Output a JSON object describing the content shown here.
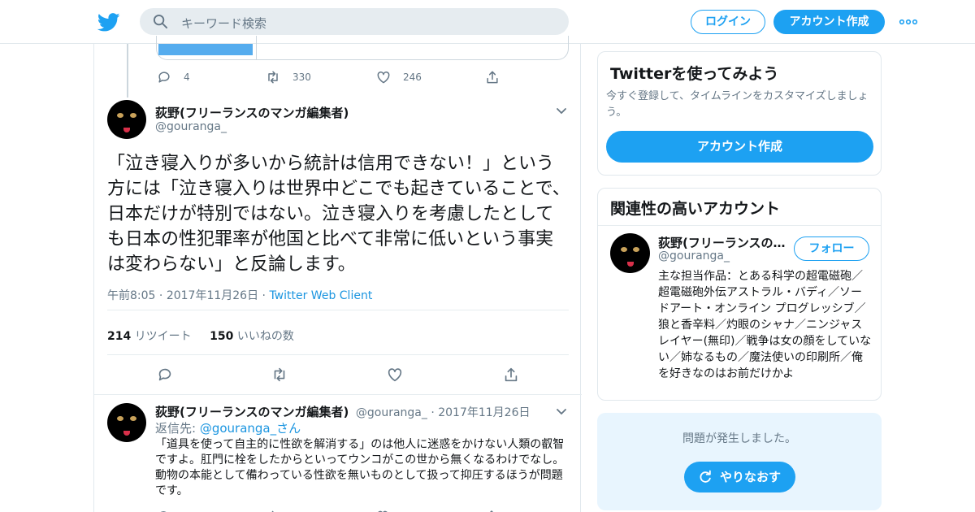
{
  "header": {
    "search_placeholder": "キーワード検索",
    "login_label": "ログイン",
    "signup_label": "アカウント作成"
  },
  "prev_tweet": {
    "replies": "4",
    "retweets": "330",
    "likes": "246"
  },
  "tweet": {
    "author_name": "荻野(フリーランスのマンガ編集者)",
    "author_handle": "@gouranga_",
    "text": "「泣き寝入りが多いから統計は信用できない！」という方には「泣き寝入りは世界中どこでも起きていることで、日本だけが特別ではない。泣き寝入りを考慮したとしても日本の性犯罪率が他国と比べて非常に低いという事実は変わらない」と反論します。",
    "time": "午前8:05",
    "date": "2017年11月26日",
    "client": "Twitter Web Client",
    "retweet_count": "214",
    "retweet_label": "リツイート",
    "like_count": "150",
    "like_label": "いいねの数"
  },
  "reply": {
    "author_name": "荻野(フリーランスのマンガ編集者)",
    "author_handle": "@gouranga_",
    "date": "2017年11月26日",
    "reply_prefix": "返信先: ",
    "reply_mention": "@gouranga_",
    "reply_suffix": "さん",
    "text": "「道具を使って自主的に性欲を解消する」のは他人に迷惑をかけない人類の叡智ですよ。肛門に栓をしたからといってウンコがこの世から無くなるわけでなし。動物の本能として備わっている性欲を無いものとして扱って抑圧するほうが問題です。"
  },
  "sidebar": {
    "try_title": "Twitterを使ってみよう",
    "try_desc": "今すぐ登録して、タイムラインをカスタマイズしましょう。",
    "try_cta": "アカウント作成",
    "related_title": "関連性の高いアカウント",
    "related_name": "荻野(フリーランスの…",
    "related_handle": "@gouranga_",
    "follow_label": "フォロー",
    "related_bio": "主な担当作品：とある科学の超電磁砲／超電磁砲外伝アストラル・バディ／ソードアート・オンライン プログレッシブ／狼と香辛料／灼眼のシャナ／ニンジャスレイヤー(無印)／戦争は女の顔をしていない／姉なるもの／魔法使いの印刷所／俺を好きなのはお前だけかよ",
    "error_msg": "問題が発生しました。",
    "retry_label": "やりなおす"
  },
  "colors": {
    "accent": "#1da1f2",
    "link": "#1b95e0",
    "muted": "#657786",
    "border": "#e1e8ed"
  }
}
